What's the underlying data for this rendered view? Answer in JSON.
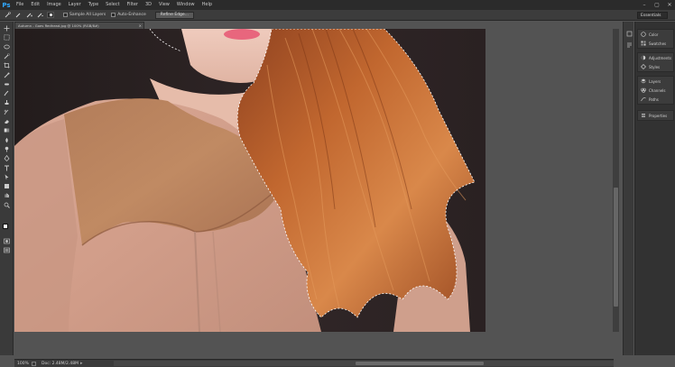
{
  "app": {
    "logo": "Ps",
    "menu": [
      "File",
      "Edit",
      "Image",
      "Layer",
      "Type",
      "Select",
      "Filter",
      "3D",
      "View",
      "Window",
      "Help"
    ],
    "window_controls": [
      "–",
      "▢",
      "✕"
    ]
  },
  "options_bar": {
    "sample_all_layers": "Sample All Layers",
    "auto_enhance": "Auto-Enhance",
    "refine_edge": "Refine Edge...",
    "workspace": "Essentials"
  },
  "document": {
    "tab_title": "Autumn - Goes Redhead.jpg @ 100% (RGB/8#)",
    "tab_close": "×",
    "zoom": "100%",
    "doc_size": "Doc: 2.48M/2.48M"
  },
  "panels": {
    "group1": [
      "Color",
      "Swatches"
    ],
    "group2": [
      "Adjustments",
      "Styles"
    ],
    "group3": [
      "Layers",
      "Channels",
      "Paths"
    ],
    "group4": [
      "Properties"
    ]
  },
  "icons": {
    "tools": [
      "move-icon",
      "marquee-icon",
      "lasso-icon",
      "quick-selection-icon",
      "crop-icon",
      "eyedropper-icon",
      "healing-icon",
      "brush-icon",
      "clone-stamp-icon",
      "history-brush-icon",
      "eraser-icon",
      "gradient-icon",
      "blur-icon",
      "dodge-icon",
      "pen-icon",
      "type-icon",
      "path-selection-icon",
      "shape-icon",
      "hand-icon",
      "zoom-icon"
    ]
  },
  "colors": {
    "accent": "#31a8ff",
    "hair": "#b5612d",
    "blouse": "#d7a592",
    "yoke": "#b07a56",
    "lips": "#e8667d",
    "background": "#2a2223"
  }
}
